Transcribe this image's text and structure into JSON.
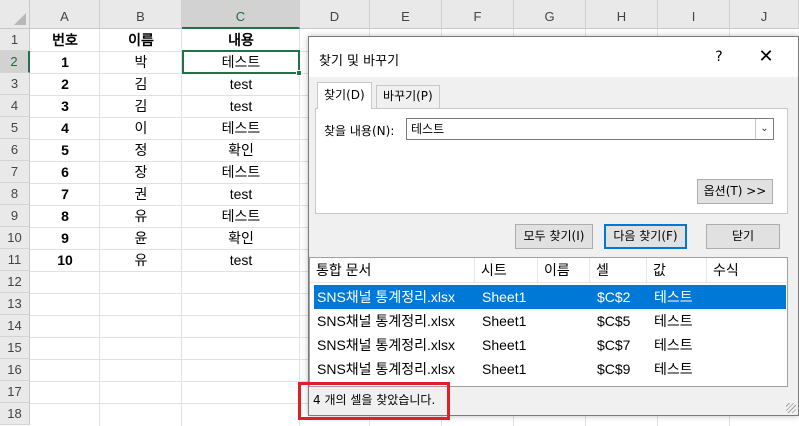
{
  "sheet": {
    "columns": [
      "A",
      "B",
      "C",
      "D",
      "E",
      "F",
      "G",
      "H",
      "I",
      "J"
    ],
    "rows": [
      "1",
      "2",
      "3",
      "4",
      "5",
      "6",
      "7",
      "8",
      "9",
      "10",
      "11",
      "12",
      "13",
      "14",
      "15",
      "16",
      "17",
      "18"
    ],
    "header": {
      "no": "번호",
      "name": "이름",
      "content": "내용"
    },
    "data": [
      {
        "no": "1",
        "name": "박",
        "content": "테스트"
      },
      {
        "no": "2",
        "name": "김",
        "content": "test"
      },
      {
        "no": "3",
        "name": "김",
        "content": "test"
      },
      {
        "no": "4",
        "name": "이",
        "content": "테스트"
      },
      {
        "no": "5",
        "name": "정",
        "content": "확인"
      },
      {
        "no": "6",
        "name": "장",
        "content": "테스트"
      },
      {
        "no": "7",
        "name": "권",
        "content": "test"
      },
      {
        "no": "8",
        "name": "유",
        "content": "테스트"
      },
      {
        "no": "9",
        "name": "윤",
        "content": "확인"
      },
      {
        "no": "10",
        "name": "유",
        "content": "test"
      }
    ],
    "active_cell": "C2",
    "accent_color": "#217346"
  },
  "dialog": {
    "title": "찾기 및 바꾸기",
    "help": "?",
    "close": "✕",
    "tabs": [
      {
        "label": "찾기(D)"
      },
      {
        "label": "바꾸기(P)"
      }
    ],
    "find_label": "찾을 내용(N):",
    "find_value": "테스트",
    "dropdown_icon": "chevron-down",
    "options_button": "옵션(T) >>",
    "find_all_button": "모두 찾기(I)",
    "find_next_button": "다음 찾기(F)",
    "close_button": "닫기",
    "results": {
      "columns": [
        "통합 문서",
        "시트",
        "이름",
        "셀",
        "값",
        "수식"
      ],
      "rows": [
        {
          "book": "SNS채널 통계정리.xlsx",
          "sheet": "Sheet1",
          "name": "",
          "cell": "$C$2",
          "value": "테스트",
          "formula": ""
        },
        {
          "book": "SNS채널 통계정리.xlsx",
          "sheet": "Sheet1",
          "name": "",
          "cell": "$C$5",
          "value": "테스트",
          "formula": ""
        },
        {
          "book": "SNS채널 통계정리.xlsx",
          "sheet": "Sheet1",
          "name": "",
          "cell": "$C$7",
          "value": "테스트",
          "formula": ""
        },
        {
          "book": "SNS채널 통계정리.xlsx",
          "sheet": "Sheet1",
          "name": "",
          "cell": "$C$9",
          "value": "테스트",
          "formula": ""
        }
      ],
      "selected_index": 0
    },
    "status": "4 개의 셀을 찾았습니다.",
    "selection_color": "#0078d7",
    "highlight_color": "#e01f26"
  }
}
